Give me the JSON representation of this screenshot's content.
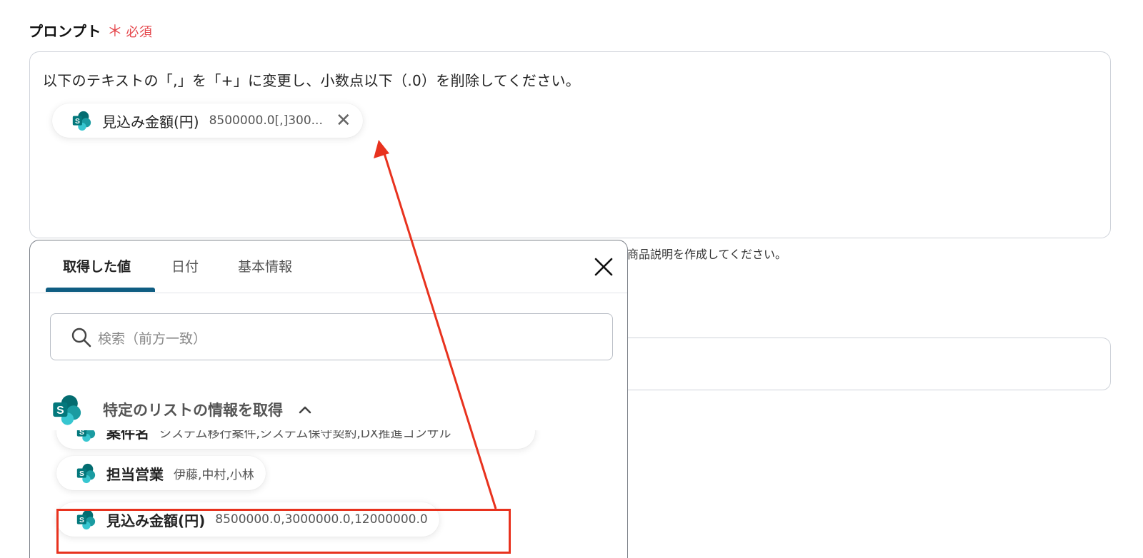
{
  "field": {
    "label": "プロンプト",
    "required_star": "＊",
    "required_text": "必須",
    "prompt_text": "以下のテキストの「,」を「+」に変更し、小数点以下（.0）を削除してください。",
    "hint_text": "商品説明を作成してください。"
  },
  "inserted_chip": {
    "icon": "sharepoint-icon",
    "name": "見込み金額(円)",
    "value": "8500000.0[,]300...",
    "close": "✕"
  },
  "panel": {
    "tabs": [
      {
        "label": "取得した値",
        "active": true
      },
      {
        "label": "日付",
        "active": false
      },
      {
        "label": "基本情報",
        "active": false
      }
    ],
    "search_placeholder": "検索（前方一致）",
    "group": {
      "icon": "sharepoint-icon",
      "title": "特定のリストの情報を取得",
      "expanded": true
    },
    "items": [
      {
        "name": "案件名",
        "value": "システム移行案件,システム保守契約,DX推進コンサル"
      },
      {
        "name": "担当営業",
        "value": "伊藤,中村,小林"
      },
      {
        "name": "見込み金額(円)",
        "value": "8500000.0,3000000.0,12000000.0"
      }
    ]
  },
  "colors": {
    "accent": "#0f5d82",
    "required": "#e5484d",
    "annotation": "#e8321e"
  }
}
